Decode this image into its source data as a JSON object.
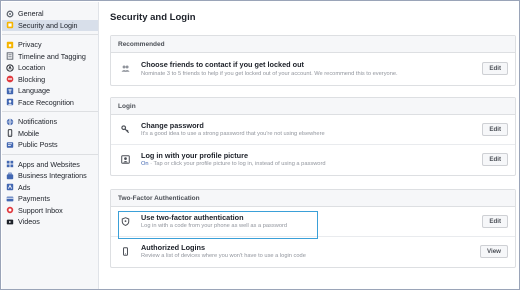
{
  "sidebar": {
    "groups": [
      [
        {
          "label": "General",
          "icon": "gear-icon"
        },
        {
          "label": "Security and Login",
          "icon": "shield-icon",
          "active": true
        }
      ],
      [
        {
          "label": "Privacy",
          "icon": "lock-icon"
        },
        {
          "label": "Timeline and Tagging",
          "icon": "timeline-icon"
        },
        {
          "label": "Location",
          "icon": "location-icon"
        },
        {
          "label": "Blocking",
          "icon": "blocking-icon"
        },
        {
          "label": "Language",
          "icon": "language-icon"
        },
        {
          "label": "Face Recognition",
          "icon": "face-recognition-icon"
        }
      ],
      [
        {
          "label": "Notifications",
          "icon": "globe-icon"
        },
        {
          "label": "Mobile",
          "icon": "mobile-icon"
        },
        {
          "label": "Public Posts",
          "icon": "public-posts-icon"
        }
      ],
      [
        {
          "label": "Apps and Websites",
          "icon": "apps-icon"
        },
        {
          "label": "Business Integrations",
          "icon": "business-icon"
        },
        {
          "label": "Ads",
          "icon": "ads-icon"
        },
        {
          "label": "Payments",
          "icon": "payments-icon"
        },
        {
          "label": "Support Inbox",
          "icon": "support-icon"
        },
        {
          "label": "Videos",
          "icon": "videos-icon"
        }
      ]
    ]
  },
  "main": {
    "title": "Security and Login",
    "recommended": {
      "header": "Recommended",
      "rows": [
        {
          "title": "Choose friends to contact if you get locked out",
          "desc": "Nominate 3 to 5 friends to help if you get locked out of your account. We recommend this to everyone.",
          "button": "Edit",
          "icon": "friends-icon"
        }
      ]
    },
    "login": {
      "header": "Login",
      "rows": [
        {
          "title": "Change password",
          "desc": "It's a good idea to use a strong password that you're not using elsewhere",
          "button": "Edit",
          "icon": "key-icon"
        },
        {
          "title": "Log in with your profile picture",
          "desc_on": "On",
          "desc": " · Tap or click your profile picture to log in, instead of using a password",
          "button": "Edit",
          "icon": "profile-picture-icon"
        }
      ]
    },
    "two_factor": {
      "header": "Two-Factor Authentication",
      "rows": [
        {
          "title": "Use two-factor authentication",
          "desc": "Log in with a code from your phone as well as a password",
          "button": "Edit",
          "icon": "shield-icon"
        },
        {
          "title": "Authorized Logins",
          "desc": "Review a list of devices where you won't have to use a login code",
          "button": "View",
          "icon": "phone-icon"
        }
      ]
    }
  },
  "colors": {
    "sidebar_bg": "#f6f7f9",
    "active_item_bg": "#d8dfea",
    "accent": "#4267b2",
    "highlight_border": "#3ba0d8"
  }
}
